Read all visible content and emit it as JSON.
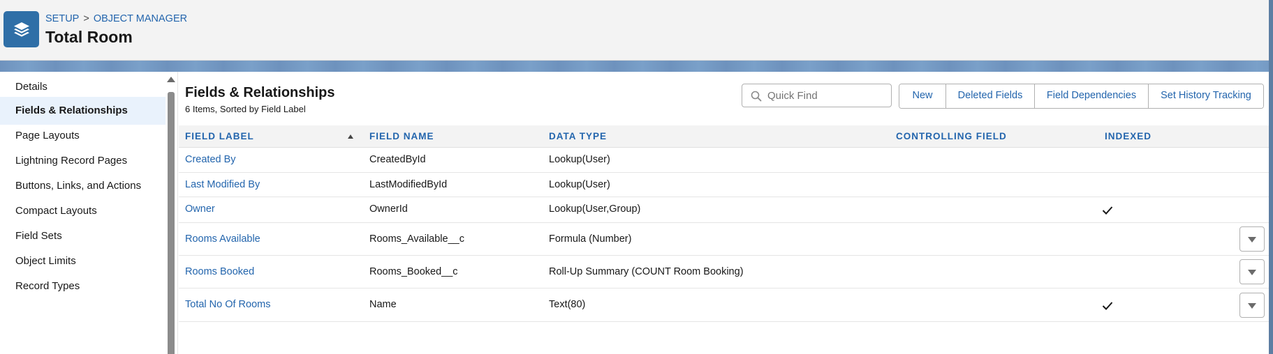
{
  "header": {
    "breadcrumb": [
      "SETUP",
      "OBJECT MANAGER"
    ],
    "breadcrumb_separator": ">",
    "title": "Total Room",
    "app_icon": "layers-icon"
  },
  "sidebar": {
    "items": [
      {
        "label": "Details",
        "active": false
      },
      {
        "label": "Fields & Relationships",
        "active": true
      },
      {
        "label": "Page Layouts",
        "active": false
      },
      {
        "label": "Lightning Record Pages",
        "active": false
      },
      {
        "label": "Buttons, Links, and Actions",
        "active": false
      },
      {
        "label": "Compact Layouts",
        "active": false
      },
      {
        "label": "Field Sets",
        "active": false
      },
      {
        "label": "Object Limits",
        "active": false
      },
      {
        "label": "Record Types",
        "active": false
      }
    ]
  },
  "main": {
    "title": "Fields & Relationships",
    "subtitle": "6 Items, Sorted by Field Label",
    "quick_find": {
      "placeholder": "Quick Find",
      "value": "",
      "icon": "search-icon"
    },
    "buttons": {
      "new": "New",
      "deleted_fields": "Deleted Fields",
      "field_dependencies": "Field Dependencies",
      "set_history_tracking": "Set History Tracking"
    },
    "columns": {
      "field_label": "Field Label",
      "field_name": "Field Name",
      "data_type": "Data Type",
      "controlling_field": "Controlling Field",
      "indexed": "Indexed"
    },
    "sorted_by": "field_label",
    "sort_direction": "ascending",
    "rows": [
      {
        "field_label": "Created By",
        "field_name": "CreatedById",
        "data_type": "Lookup(User)",
        "controlling_field": "",
        "indexed": false,
        "has_menu": false
      },
      {
        "field_label": "Last Modified By",
        "field_name": "LastModifiedById",
        "data_type": "Lookup(User)",
        "controlling_field": "",
        "indexed": false,
        "has_menu": false
      },
      {
        "field_label": "Owner",
        "field_name": "OwnerId",
        "data_type": "Lookup(User,Group)",
        "controlling_field": "",
        "indexed": true,
        "has_menu": false
      },
      {
        "field_label": "Rooms Available",
        "field_name": "Rooms_Available__c",
        "data_type": "Formula (Number)",
        "controlling_field": "",
        "indexed": false,
        "has_menu": true
      },
      {
        "field_label": "Rooms Booked",
        "field_name": "Rooms_Booked__c",
        "data_type": "Roll-Up Summary (COUNT Room Booking)",
        "controlling_field": "",
        "indexed": false,
        "has_menu": true
      },
      {
        "field_label": "Total No Of Rooms",
        "field_name": "Name",
        "data_type": "Text(80)",
        "controlling_field": "",
        "indexed": true,
        "has_menu": true
      }
    ]
  },
  "colors": {
    "link": "#2365ad",
    "brand": "#2f6fa7",
    "header_bg": "#f3f3f3",
    "active_nav_bg": "#e9f2fc"
  }
}
